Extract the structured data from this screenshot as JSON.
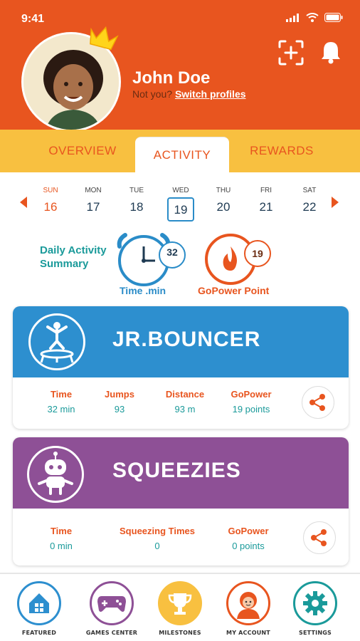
{
  "status": {
    "time": "9:41"
  },
  "profile": {
    "name": "John Doe",
    "not_you": "Not you?",
    "switch_label": "Switch profiles"
  },
  "tabs": [
    {
      "label": "OVERVIEW",
      "active": false
    },
    {
      "label": "ACTIVITY",
      "active": true
    },
    {
      "label": "REWARDS",
      "active": false
    }
  ],
  "calendar": {
    "days": [
      {
        "name": "SUN",
        "date": "16"
      },
      {
        "name": "MON",
        "date": "17"
      },
      {
        "name": "TUE",
        "date": "18"
      },
      {
        "name": "WED",
        "date": "19"
      },
      {
        "name": "THU",
        "date": "20"
      },
      {
        "name": "FRI",
        "date": "21"
      },
      {
        "name": "SAT",
        "date": "22"
      }
    ],
    "selected": "19"
  },
  "summary": {
    "label": "Daily Activity Summary",
    "time_value": "32",
    "time_caption": "Time .min",
    "points_value": "19",
    "points_caption": "GoPower Point"
  },
  "activities": [
    {
      "title": "JR.BOUNCER",
      "icon": "trampoline-icon",
      "color": "#2d8fcf",
      "stats": [
        {
          "label": "Time",
          "value": "32 min"
        },
        {
          "label": "Jumps",
          "value": "93"
        },
        {
          "label": "Distance",
          "value": "93 m"
        },
        {
          "label": "GoPower",
          "value": "19 points"
        }
      ]
    },
    {
      "title": "SQUEEZIES",
      "icon": "robot-icon",
      "color": "#8e5096",
      "stats": [
        {
          "label": "Time",
          "value": "0 min"
        },
        {
          "label": "Squeezing Times",
          "value": "0"
        },
        {
          "label": "GoPower",
          "value": "0  points"
        }
      ]
    }
  ],
  "nav": [
    {
      "label": "FEATURED",
      "icon": "house-icon",
      "color": "#2d8fcf"
    },
    {
      "label": "GAMES CENTER",
      "icon": "gamepad-icon",
      "color": "#8e5096"
    },
    {
      "label": "MILESTONES",
      "icon": "trophy-icon",
      "color": "#f8c040"
    },
    {
      "label": "MY ACCOUNT",
      "icon": "account-icon",
      "color": "#e8551f"
    },
    {
      "label": "SETTINGS",
      "icon": "gear-icon",
      "color": "#1a9a9a"
    }
  ]
}
